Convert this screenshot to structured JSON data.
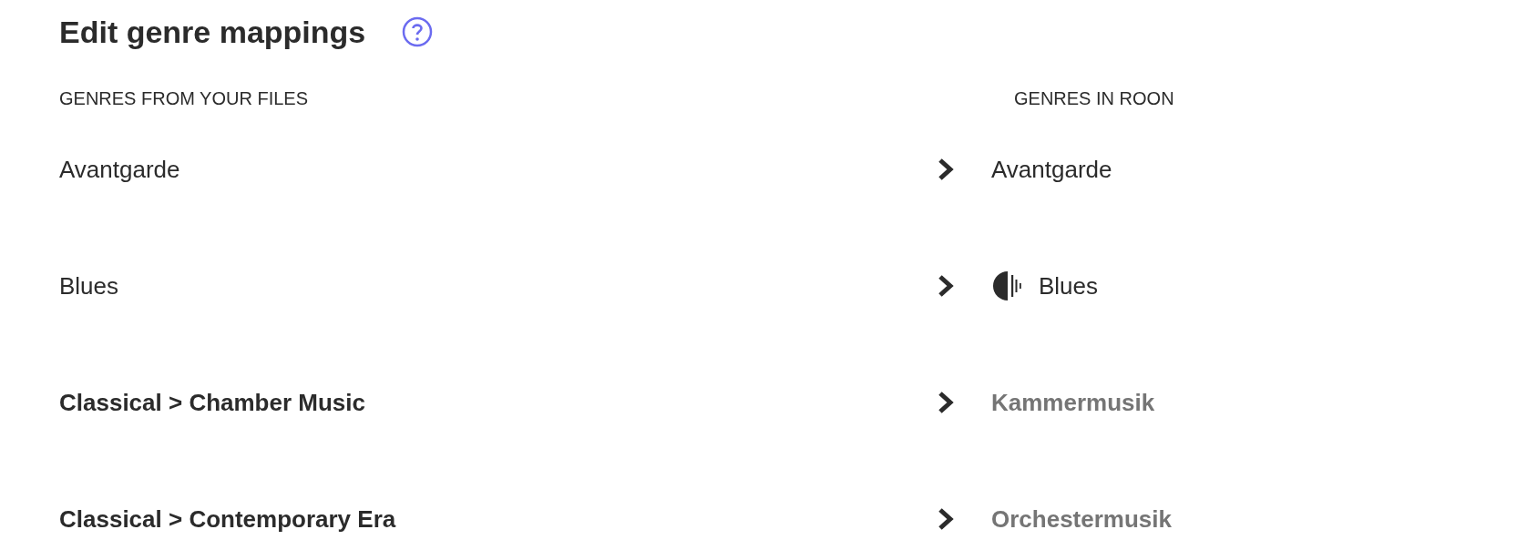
{
  "title": "Edit genre mappings",
  "columns": {
    "source": "GENRES FROM YOUR FILES",
    "target": "GENRES IN ROON"
  },
  "rows": [
    {
      "source": {
        "text": "Avantgarde",
        "kind": "genre"
      },
      "target": {
        "text": "Avantgarde",
        "kind": "plain"
      }
    },
    {
      "source": {
        "text": "Blues",
        "kind": "genre"
      },
      "target": {
        "text": "Blues",
        "kind": "with_icon"
      }
    },
    {
      "source": {
        "text": "Classical > Chamber Music",
        "kind": "subgenre"
      },
      "target": {
        "text": "Kammermusik",
        "kind": "muted"
      }
    },
    {
      "source": {
        "text": "Classical > Contemporary Era",
        "kind": "subgenre"
      },
      "target": {
        "text": "Orchestermusik",
        "kind": "muted"
      }
    }
  ]
}
